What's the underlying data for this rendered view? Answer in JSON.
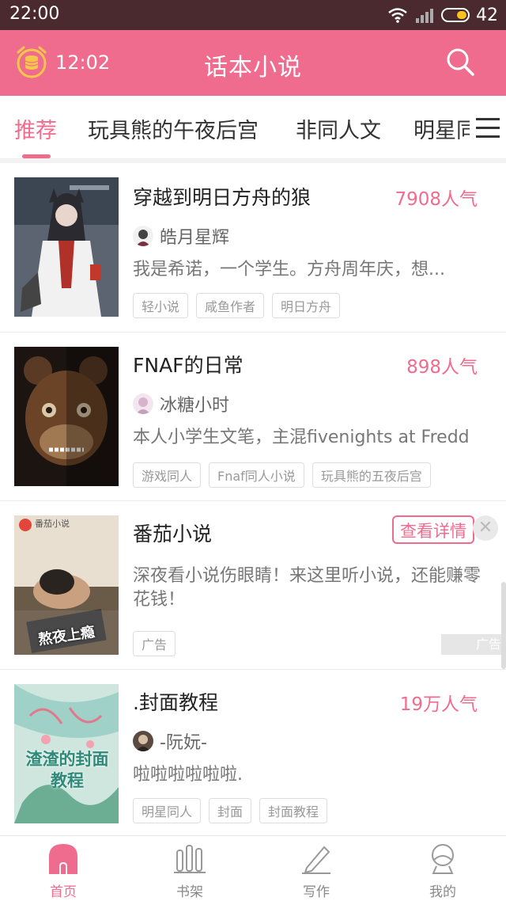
{
  "status_bar": {
    "time": "22:00",
    "battery": "42"
  },
  "header": {
    "clock": "12:02",
    "title": "话本小说"
  },
  "tabs": [
    {
      "label": "推荐",
      "active": true
    },
    {
      "label": "玩具熊的午夜后宫"
    },
    {
      "label": "非同人文"
    },
    {
      "label": "明星同"
    }
  ],
  "books": [
    {
      "title": "穿越到明日方舟的狼",
      "popularity": "7908人气",
      "author": "皓月星辉",
      "description": "我是希诺，一个学生。方舟周年庆，想...",
      "tags": [
        "轻小说",
        "咸鱼作者",
        "明日方舟"
      ]
    },
    {
      "title": "FNAF的日常",
      "popularity": "898人气",
      "author": "冰糖小时",
      "description": "本人小学生文笔，主混fivenights at Fredd",
      "tags": [
        "游戏同人",
        "Fnaf同人小说",
        "玩具熊的五夜后宫"
      ]
    }
  ],
  "ad": {
    "title": "番茄小说",
    "detail_label": "查看详情",
    "close_label": "✕",
    "description": "深夜看小说伤眼睛！来这里听小说，还能赚零花钱！",
    "tag": "广告",
    "badge": "广告",
    "cover_top_text": "番茄小说",
    "cover_caption": "熬夜上瘾"
  },
  "book3": {
    "title": ".封面教程",
    "popularity": "19万人气",
    "author": "-阮妧-",
    "description": "啦啦啦啦啦啦.",
    "tags": [
      "明星同人",
      "封面",
      "封面教程"
    ],
    "cover_text": "渣渣的封面教程"
  },
  "bottom_nav": [
    {
      "label": "首页",
      "icon": "home-icon",
      "active": true
    },
    {
      "label": "书架",
      "icon": "bookshelf-icon"
    },
    {
      "label": "写作",
      "icon": "pen-icon"
    },
    {
      "label": "我的",
      "icon": "profile-icon"
    }
  ],
  "colors": {
    "accent": "#f06c8e",
    "status_bar": "#4a2a2e"
  }
}
